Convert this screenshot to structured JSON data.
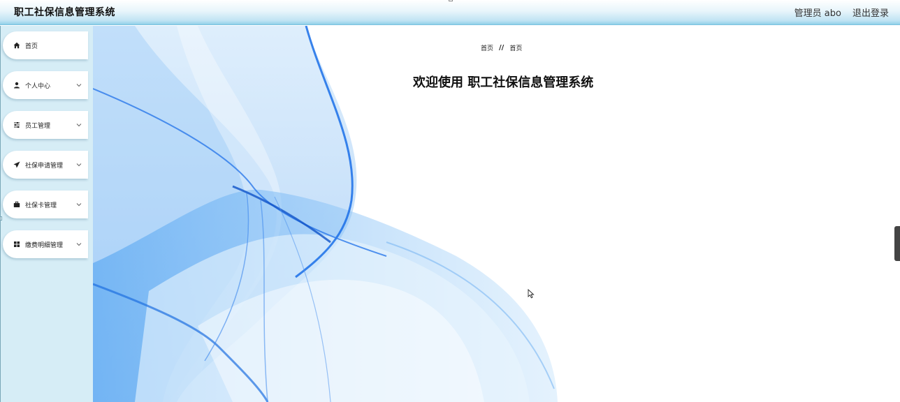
{
  "header": {
    "app_title": "职工社保信息管理系统",
    "user_label": "管理员 abo",
    "logout_label": "退出登录"
  },
  "sidebar": {
    "items": [
      {
        "label": "首页",
        "icon": "home-icon",
        "has_submenu": false
      },
      {
        "label": "个人中心",
        "icon": "user-icon",
        "has_submenu": true
      },
      {
        "label": "员工管理",
        "icon": "sliders-icon",
        "has_submenu": true
      },
      {
        "label": "社保申请管理",
        "icon": "send-icon",
        "has_submenu": true
      },
      {
        "label": "社保卡管理",
        "icon": "briefcase-icon",
        "has_submenu": true
      },
      {
        "label": "缴费明细管理",
        "icon": "grid-icon",
        "has_submenu": true
      }
    ]
  },
  "main": {
    "breadcrumb": {
      "first": "首页",
      "separator": "//",
      "second": "首页"
    },
    "welcome_text": "欢迎使用 职工社保信息管理系统"
  },
  "colors": {
    "header_gradient_end": "#8fcfe8",
    "sidebar_bg": "#d6edf6",
    "wave_blue": "#1a6fe8"
  }
}
